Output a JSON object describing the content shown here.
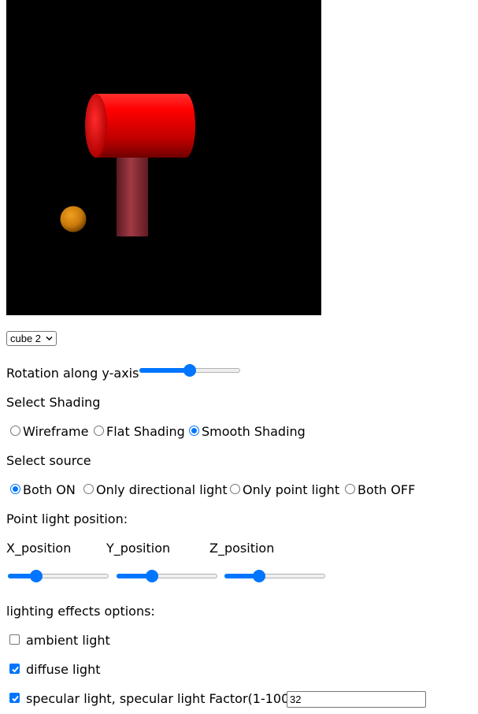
{
  "scene": {
    "background": "#000000",
    "objects": [
      {
        "name": "red horizontal cylinder",
        "color": "#e00000"
      },
      {
        "name": "dark red vertical cylinder",
        "color": "#8a2a32"
      },
      {
        "name": "orange sphere",
        "color": "#d4850a"
      }
    ]
  },
  "object_select": {
    "value": "cube 2",
    "icon": "chevron-down-icon"
  },
  "rotation": {
    "label": "Rotation along y-axis",
    "value": 0.5
  },
  "shading": {
    "title": "Select Shading",
    "options": [
      "Wireframe",
      "Flat Shading",
      "Smooth Shading"
    ],
    "selected": "Smooth Shading"
  },
  "source": {
    "title": "Select source",
    "options": [
      "Both ON",
      "Only directional light",
      "Only point light",
      "Both OFF"
    ],
    "selected": "Both ON"
  },
  "point_light": {
    "title": "Point light position:",
    "x_label": "X_position",
    "y_label": "Y_position",
    "z_label": "Z_position",
    "x_value": 0.25,
    "y_value": 0.33,
    "z_value": 0.32
  },
  "lighting": {
    "title": "lighting effects options:",
    "ambient_label": "ambient light",
    "ambient_checked": false,
    "diffuse_label": "diffuse light",
    "diffuse_checked": true,
    "specular_label": "specular light, specular light Factor(1-100):",
    "specular_checked": true,
    "specular_factor": "32"
  },
  "accent_color": "#0075ff"
}
